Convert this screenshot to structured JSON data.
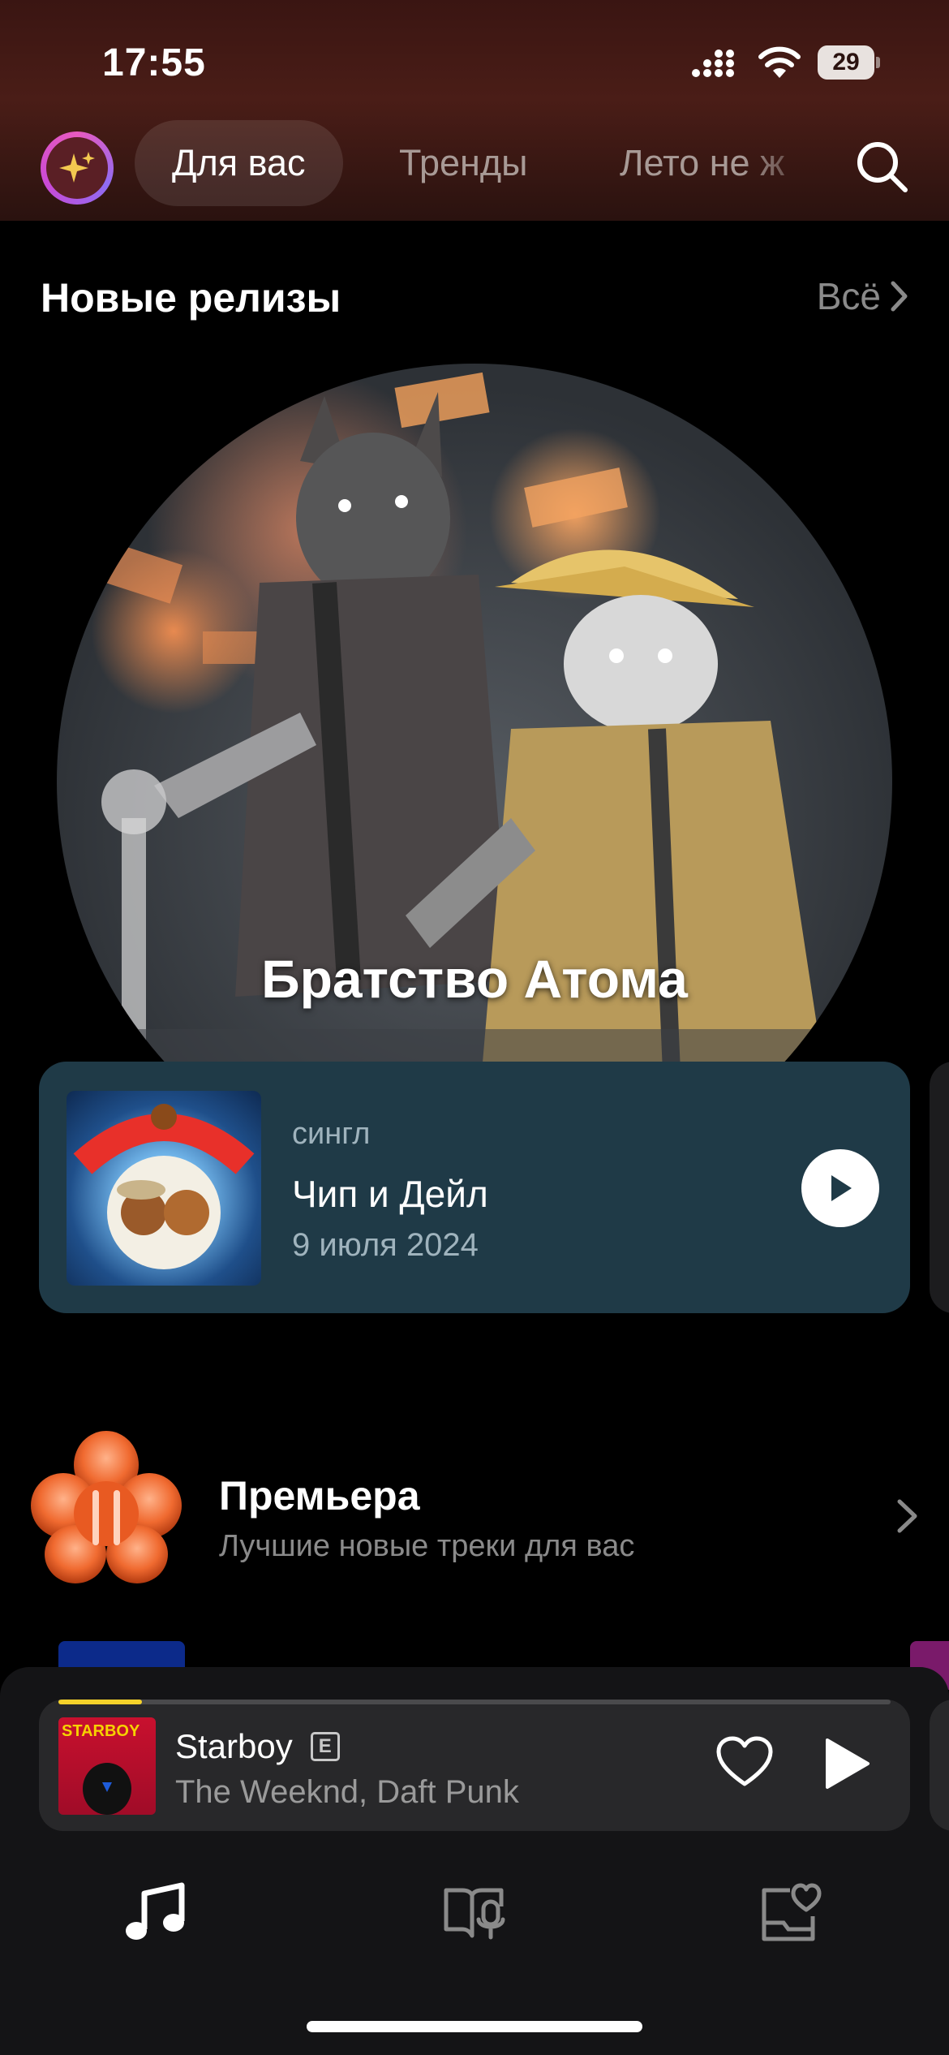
{
  "status_bar": {
    "time": "17:55",
    "battery_level": "29",
    "icons": [
      "signal-icon",
      "wifi-icon",
      "battery-icon"
    ]
  },
  "top_tabs": {
    "items": [
      {
        "label": "Для вас",
        "active": true
      },
      {
        "label": "Тренды",
        "active": false
      },
      {
        "label": "Лето не ж",
        "active": false
      }
    ],
    "avatar_icon": "sparkles-icon",
    "search_icon": "search-icon"
  },
  "new_releases": {
    "title": "Новые релизы",
    "see_all_label": "Всё",
    "cover_title": "Братство Атома",
    "card": {
      "type": "сингл",
      "title": "Чип и Дейл",
      "date": "9 июля 2024",
      "play_icon": "play-icon"
    }
  },
  "premiere": {
    "title": "Премьера",
    "subtitle": "Лучшие новые треки для вас",
    "icon": "flower-logo-icon"
  },
  "mini_player": {
    "track_title": "Starboy",
    "explicit_label": "E",
    "artists": "The Weeknd, Daft Punk",
    "art_text": "STARBOY",
    "progress": 0.1,
    "like_icon": "heart-icon",
    "play_icon": "play-icon"
  },
  "bottom_nav": {
    "items": [
      {
        "name": "music",
        "icon": "music-note-icon",
        "active": true
      },
      {
        "name": "podcasts-books",
        "icon": "book-mic-icon",
        "active": false
      },
      {
        "name": "collection",
        "icon": "heart-folder-icon",
        "active": false
      }
    ]
  },
  "colors": {
    "background": "#000000",
    "header_gradient": "#4a1d17",
    "card_bg": "#1f3a47",
    "progress_accent": "#f5d22a",
    "muted_text": "#8a8a8a"
  }
}
